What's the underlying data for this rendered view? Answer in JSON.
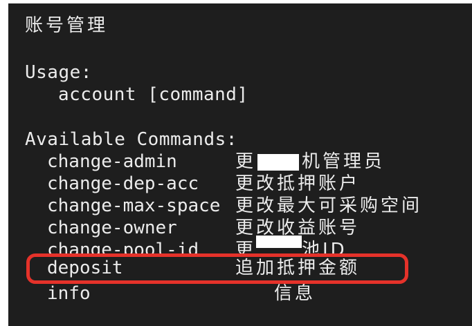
{
  "title": "账号管理",
  "usage": {
    "heading": "Usage:",
    "syntax": "account [command]"
  },
  "available_heading": "Available Commands:",
  "commands": [
    {
      "name": "change-admin",
      "desc_a": "更",
      "desc_b": "机管理员"
    },
    {
      "name": "change-dep-acc",
      "desc": "更改抵押账户"
    },
    {
      "name": "change-max-space",
      "desc": "更改最大可采购空间"
    },
    {
      "name": "change-owner",
      "desc": "更改收益账号"
    },
    {
      "name": "change-pool-id",
      "desc_a": "更",
      "desc_b": "池ID"
    },
    {
      "name": "deposit",
      "desc": "追加抵押金额"
    },
    {
      "name": "info",
      "desc_b": "信息"
    }
  ],
  "colors": {
    "background": "#1e1e1e",
    "text": "#ececec",
    "highlight": "#e5322a"
  }
}
